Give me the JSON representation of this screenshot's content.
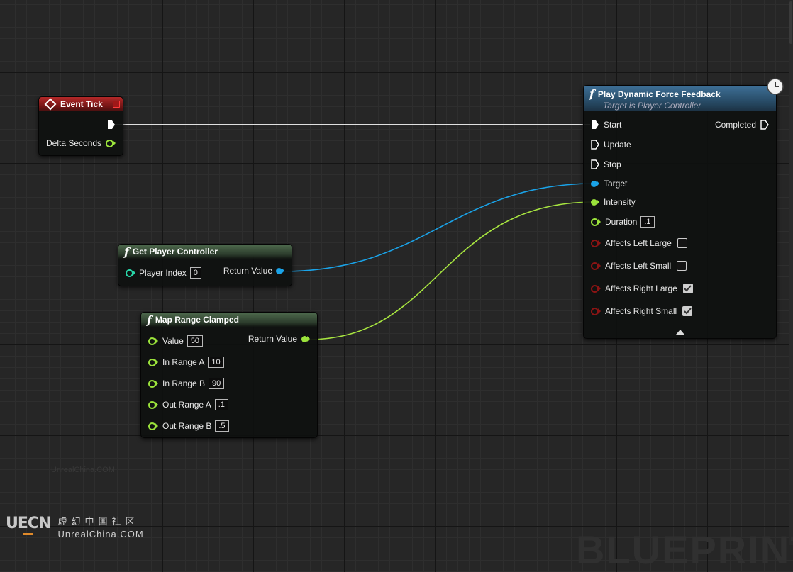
{
  "event_tick": {
    "title": "Event Tick",
    "pins": {
      "delta_seconds": "Delta Seconds"
    }
  },
  "get_player_controller": {
    "title": "Get Player Controller",
    "inputs": {
      "player_index_label": "Player Index",
      "player_index_value": "0"
    },
    "outputs": {
      "return_value": "Return Value"
    }
  },
  "map_range_clamped": {
    "title": "Map Range Clamped",
    "inputs": [
      {
        "label": "Value",
        "value": "50"
      },
      {
        "label": "In Range A",
        "value": "10"
      },
      {
        "label": "In Range B",
        "value": "90"
      },
      {
        "label": "Out Range A",
        "value": ".1"
      },
      {
        "label": "Out Range B",
        "value": ".5"
      }
    ],
    "outputs": {
      "return_value": "Return Value"
    }
  },
  "play_dynamic_force_feedback": {
    "title": "Play Dynamic Force Feedback",
    "subtitle": "Target is Player Controller",
    "exec_pins": {
      "start": "Start",
      "update": "Update",
      "stop": "Stop",
      "completed": "Completed"
    },
    "pins": {
      "target": "Target",
      "intensity": "Intensity",
      "duration_label": "Duration",
      "duration_value": ".1",
      "affects_left_large": "Affects Left Large",
      "affects_left_small": "Affects Left Small",
      "affects_right_large": "Affects Right Large",
      "affects_right_small": "Affects Right Small"
    },
    "checkboxes": {
      "affects_left_large": false,
      "affects_left_small": false,
      "affects_right_large": true,
      "affects_right_small": true
    }
  },
  "watermark": {
    "small": "UnrealChina.COM",
    "logo_mark": "UECN",
    "cn": "虚幻中国社区",
    "en": "UnrealChina.COM",
    "blueprint": "BLUEPRINT"
  },
  "colors": {
    "exec_wire": "#e8e8e8",
    "object_pin": "#1aa3e8",
    "float_pin": "#9be33b",
    "bool_pin": "#8c1414",
    "int_pin": "#28d6a8"
  }
}
